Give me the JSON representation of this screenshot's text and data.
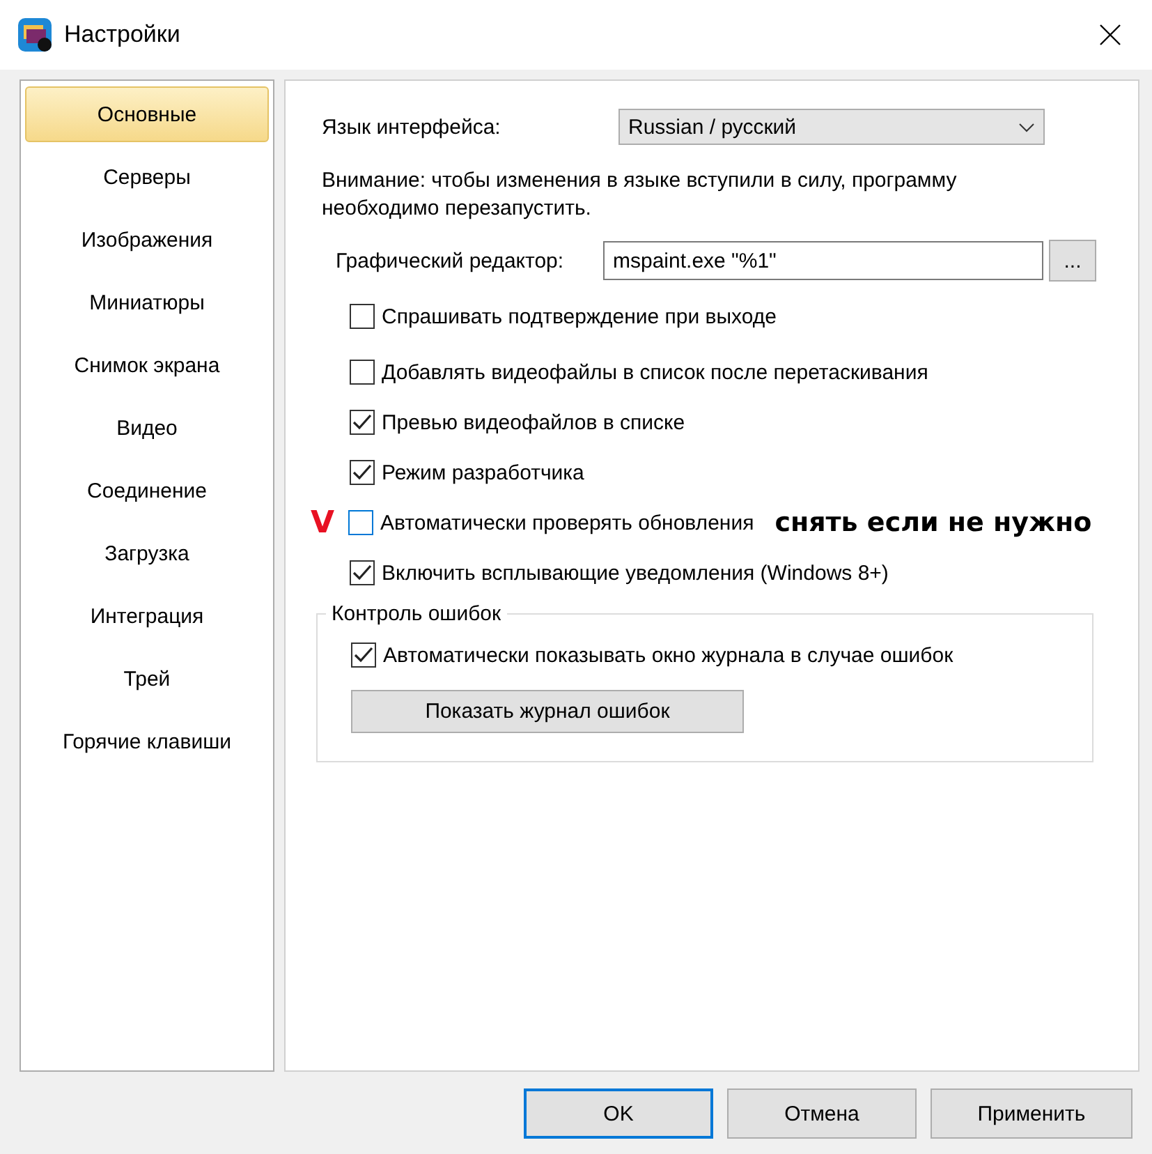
{
  "window": {
    "title": "Настройки"
  },
  "sidebar": {
    "items": [
      {
        "label": "Основные",
        "selected": true
      },
      {
        "label": "Серверы",
        "selected": false
      },
      {
        "label": "Изображения",
        "selected": false
      },
      {
        "label": "Миниатюры",
        "selected": false
      },
      {
        "label": "Снимок экрана",
        "selected": false
      },
      {
        "label": "Видео",
        "selected": false
      },
      {
        "label": "Соединение",
        "selected": false
      },
      {
        "label": "Загрузка",
        "selected": false
      },
      {
        "label": "Интеграция",
        "selected": false
      },
      {
        "label": "Трей",
        "selected": false
      },
      {
        "label": "Горячие клавиши",
        "selected": false
      }
    ]
  },
  "language": {
    "label": "Язык интерфейса:",
    "value": "Russian / русский"
  },
  "notice": "Внимание: чтобы изменения в языке вступили в силу, программу необходимо перезапустить.",
  "editor": {
    "label": "Графический редактор:",
    "value": "mspaint.exe \"%1\"",
    "browse": "..."
  },
  "options": [
    {
      "label": "Спрашивать подтверждение при выходе",
      "checked": false,
      "focused": false
    },
    {
      "label": "Добавлять видеофайлы в список после перетаскивания",
      "checked": false,
      "focused": false
    },
    {
      "label": "Превью видеофайлов в списке",
      "checked": true,
      "focused": false
    },
    {
      "label": "Режим разработчика",
      "checked": true,
      "focused": false
    },
    {
      "label": "Автоматически проверять обновления",
      "checked": false,
      "focused": true,
      "mark": "V",
      "note": "снять если не нужно"
    },
    {
      "label": "Включить всплывающие уведомления (Windows 8+)",
      "checked": true,
      "focused": false
    }
  ],
  "error_group": {
    "title": "Контроль ошибок",
    "option": {
      "label": "Автоматически показывать окно журнала в случае ошибок",
      "checked": true,
      "focused": false
    },
    "button": "Показать журнал ошибок"
  },
  "buttons": [
    {
      "label": "OK",
      "default": true
    },
    {
      "label": "Отмена",
      "default": false
    },
    {
      "label": "Применить",
      "default": false
    }
  ]
}
